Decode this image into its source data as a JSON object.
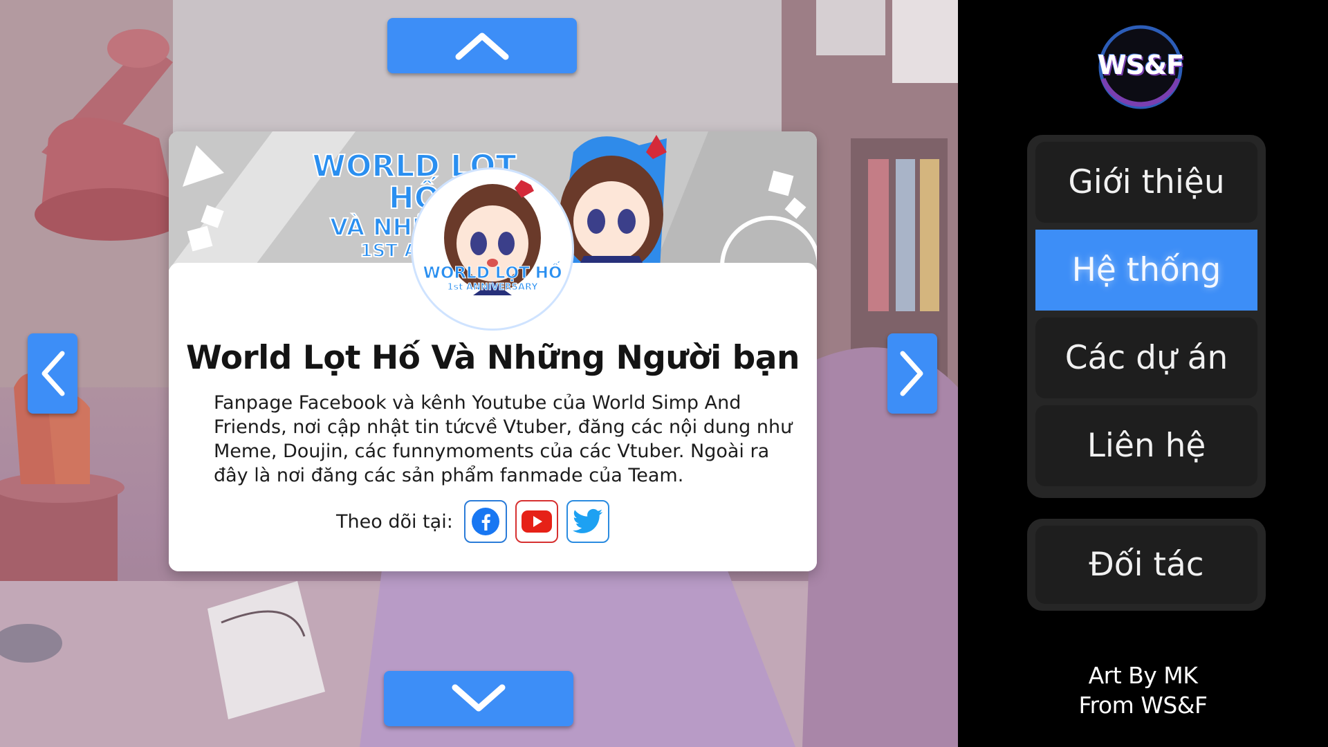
{
  "nav": {
    "up_icon": "chevron-up-icon",
    "down_icon": "chevron-down-icon",
    "left_icon": "chevron-left-icon",
    "right_icon": "chevron-right-icon",
    "accent_color": "#3d8ef7"
  },
  "card": {
    "banner_text_line1": "WORLD LỌT HỐ",
    "banner_text_line2": "VÀ NHỮNG N",
    "banner_text_line3": "1ST ANNIV",
    "avatar_text_line1": "WORLD LỌT HỐ",
    "avatar_text_line2": "1st ANNIVERSARY",
    "title": "World Lọt Hố Và Những Người bạn",
    "description": "Fanpage Facebook và kênh Youtube của World Simp And Friends, nơi cập nhật tin tứcvề Vtuber, đăng các nội dung như Meme, Doujin, các funnymoments của các Vtuber. Ngoài ra đây là nơi đăng các sản phẩm fanmade của Team.",
    "follow_label": "Theo dõi tại:",
    "socials": [
      {
        "icon": "facebook-icon",
        "color": "#1877f2"
      },
      {
        "icon": "youtube-icon",
        "color": "#e62117"
      },
      {
        "icon": "twitter-icon",
        "color": "#1da1f2"
      }
    ]
  },
  "sidebar": {
    "logo_text": "WS&F",
    "menu": [
      {
        "label": "Giới thiệu",
        "active": false
      },
      {
        "label": "Hệ thống",
        "active": true
      },
      {
        "label": "Các dự án",
        "active": false
      },
      {
        "label": "Liên hệ",
        "active": false
      }
    ],
    "partner_label": "Đối tác",
    "credit_line1": "Art By MK",
    "credit_line2": "From WS&F"
  }
}
